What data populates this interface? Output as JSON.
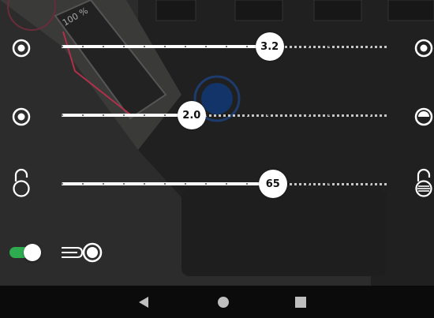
{
  "sliders": [
    {
      "name": "slider-1",
      "value_label": "3.2",
      "fraction": 0.64
    },
    {
      "name": "slider-2",
      "value_label": "2.0",
      "fraction": 0.4
    },
    {
      "name": "slider-3",
      "value_label": "65",
      "fraction": 0.65
    }
  ],
  "left_icons": [
    "target-icon",
    "target-icon",
    "lock-open-icon"
  ],
  "right_icons": [
    "target-icon",
    "half-circle-icon",
    "lock-fill-icon"
  ],
  "background_label": "100 %",
  "toggle": {
    "on": true,
    "color": "#2eaa4f"
  },
  "fan_icon": "fan-wind-icon",
  "nav": [
    "back-icon",
    "home-icon",
    "recents-icon"
  ]
}
